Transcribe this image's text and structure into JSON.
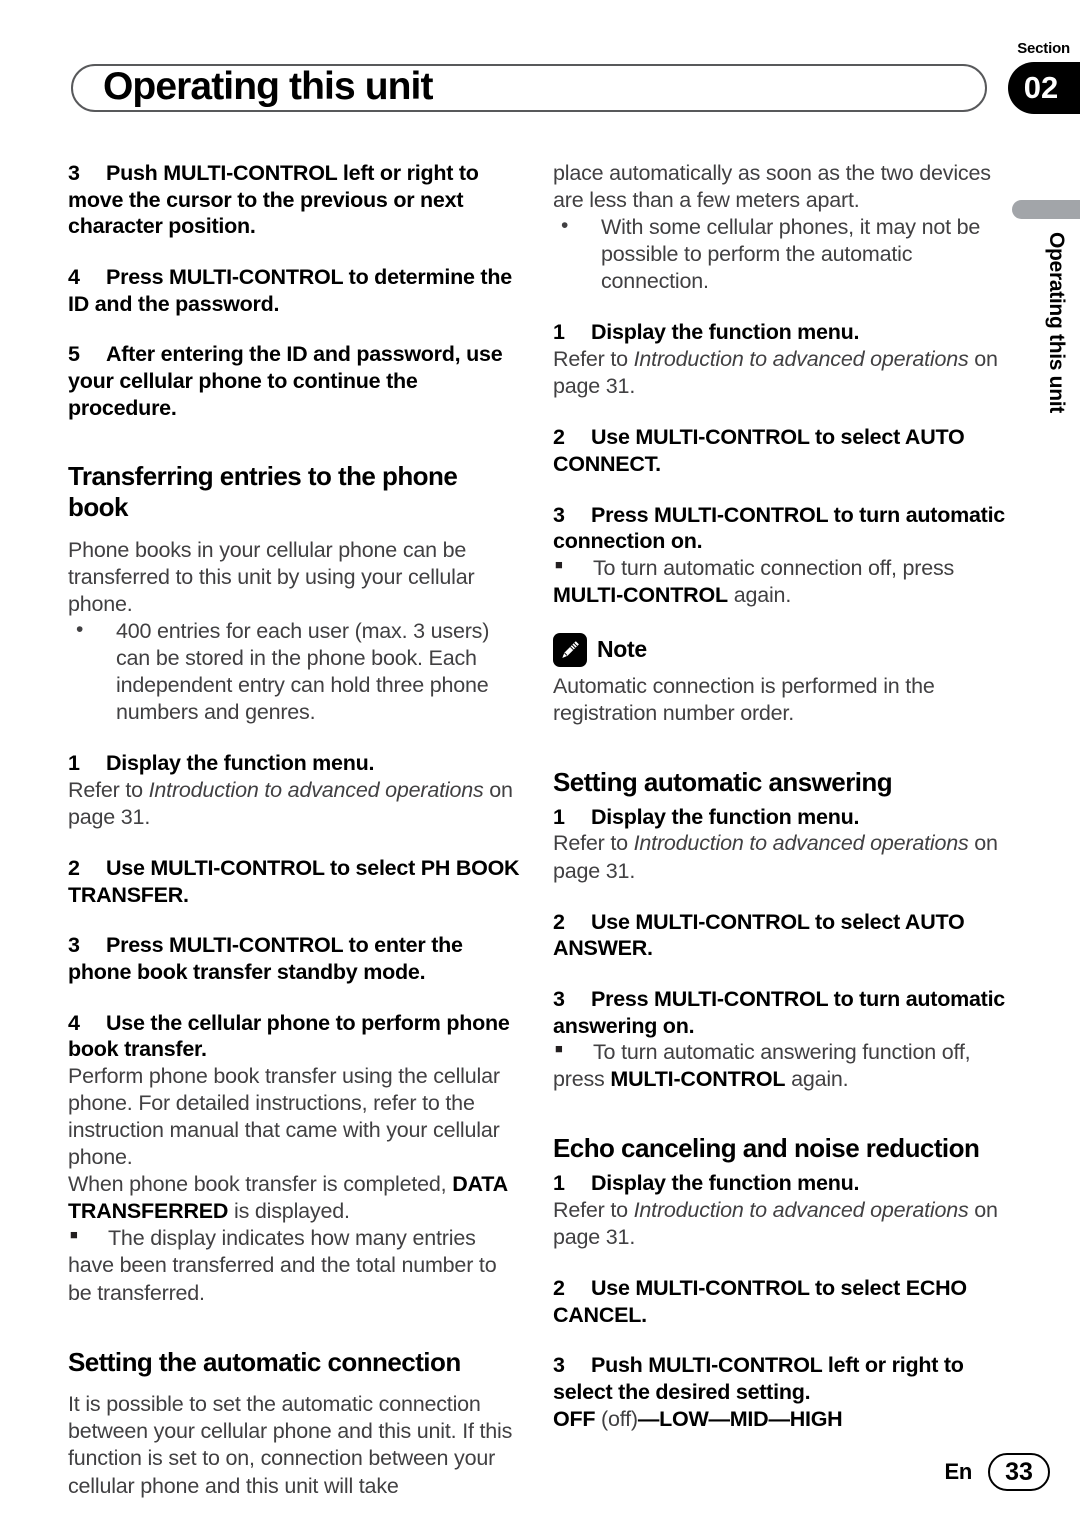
{
  "header": {
    "section_label": "Section",
    "section_number": "02",
    "title": "Operating this unit"
  },
  "side_tab": {
    "text": "Operating this unit"
  },
  "footer": {
    "language": "En",
    "page_number": "33"
  },
  "icons": {
    "note_icon": "pencil-icon"
  },
  "left_column": {
    "step3": {
      "num": "3",
      "text": "Push MULTI-CONTROL left or right to move the cursor to the previous or next character position."
    },
    "step4": {
      "num": "4",
      "text": "Press MULTI-CONTROL to determine the ID and the password."
    },
    "step5": {
      "num": "5",
      "text": "After entering the ID and password, use your cellular phone to continue the procedure."
    },
    "heading_transferring": "Transferring entries to the phone book",
    "intro_transferring": "Phone books in your cellular phone can be transferred to this unit by using your cellular phone.",
    "bullet_400_entries": "400 entries for each user (max. 3 users) can be stored in the phone book. Each independent entry can hold three phone numbers and genres.",
    "step1": {
      "num": "1",
      "text": "Display the function menu."
    },
    "refer_prefix": "Refer to ",
    "refer_italic": "Introduction to advanced operations",
    "refer_suffix": " on page 31.",
    "step2": {
      "num": "2",
      "text": "Use MULTI-CONTROL to select PH BOOK TRANSFER."
    },
    "step3b": {
      "num": "3",
      "text": "Press MULTI-CONTROL to enter the phone book transfer standby mode."
    },
    "step4b": {
      "num": "4",
      "text": "Use the cellular phone to perform phone book transfer."
    },
    "perform_text": "Perform phone book transfer using the cellular phone. For detailed instructions, refer to the instruction manual that came with your cellular phone.",
    "when_completed_prefix": "When phone book transfer is completed, ",
    "data_transferred_bold": "DATA TRANSFERRED",
    "when_completed_suffix": " is displayed.",
    "bullet_display_indicates": "The display indicates how many entries have been transferred and the total number to be transferred.",
    "heading_auto_connection": "Setting the automatic connection",
    "intro_auto_connection": "It is possible to set the automatic connection between your cellular phone and this unit. If this function is set to on, connection between your cellular phone and this unit will take"
  },
  "right_column": {
    "continued_text": "place automatically as soon as the two devices are less than a few meters apart.",
    "bullet_some_phones": "With some cellular phones, it may not be possible to perform the automatic connection.",
    "step1": {
      "num": "1",
      "text": "Display the function menu."
    },
    "refer_prefix": "Refer to ",
    "refer_italic": "Introduction to advanced operations",
    "refer_suffix": " on page 31.",
    "step2_auto_connect": {
      "num": "2",
      "text": "Use MULTI-CONTROL to select AUTO CONNECT."
    },
    "step3_auto_connect": {
      "num": "3",
      "text": "Press MULTI-CONTROL to turn automatic connection on."
    },
    "bullet_turn_off_prefix": "To turn automatic connection off, press ",
    "bullet_turn_off_bold": "MULTI-CONTROL",
    "bullet_turn_off_suffix": " again.",
    "note_label": "Note",
    "note_text": "Automatic connection is performed in the registration number order.",
    "heading_auto_answering": "Setting automatic answering",
    "step1b": {
      "num": "1",
      "text": "Display the function menu."
    },
    "step2_auto_answer": {
      "num": "2",
      "text": "Use MULTI-CONTROL to select AUTO ANSWER."
    },
    "step3_auto_answer": {
      "num": "3",
      "text": "Press MULTI-CONTROL to turn automatic answering on."
    },
    "bullet_answer_off_prefix": "To turn automatic answering function off, press ",
    "bullet_answer_off_bold": "MULTI-CONTROL",
    "bullet_answer_off_suffix": " again.",
    "heading_echo": "Echo canceling and noise reduction",
    "step1c": {
      "num": "1",
      "text": "Display the function menu."
    },
    "step2_echo": {
      "num": "2",
      "text": "Use MULTI-CONTROL to select ECHO CANCEL."
    },
    "step3_echo": {
      "num": "3",
      "text": "Push MULTI-CONTROL left or right to select the desired setting."
    },
    "settings_off_bold": "OFF",
    "settings_off_plain": " (off)",
    "settings_dash1": "—",
    "settings_low": "LOW",
    "settings_dash2": "—",
    "settings_mid": "MID",
    "settings_dash3": "—",
    "settings_high": "HIGH"
  }
}
